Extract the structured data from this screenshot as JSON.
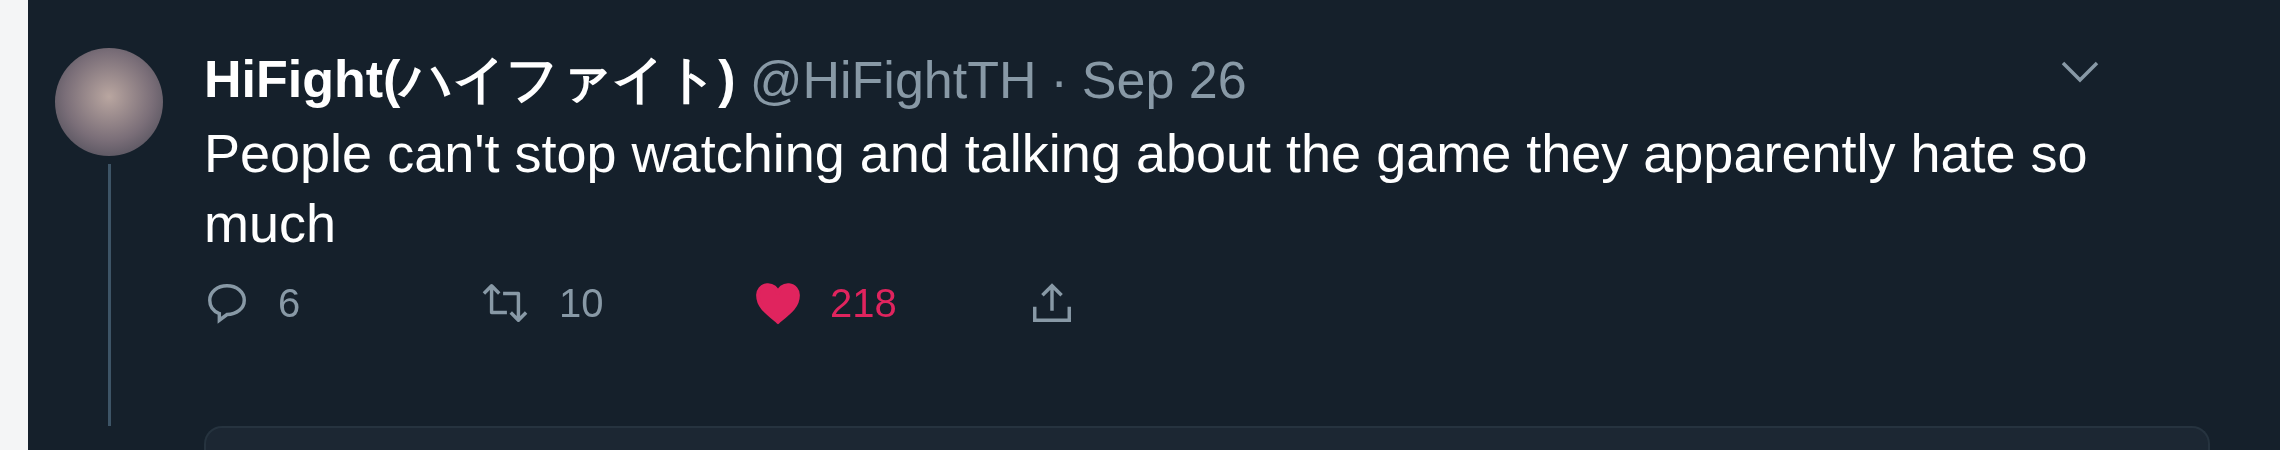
{
  "tweet": {
    "display_name": "HiFight(ハイファイト)",
    "handle": "@HiFightTH",
    "separator": "·",
    "date": "Sep 26",
    "text": "People can't stop watching and talking about the game they apparently hate so much",
    "actions": [
      {
        "kind": "reply",
        "count": "6",
        "selected": false
      },
      {
        "kind": "retweet",
        "count": "10",
        "selected": false
      },
      {
        "kind": "like",
        "count": "218",
        "selected": true
      },
      {
        "kind": "share",
        "selected": false
      }
    ]
  }
}
